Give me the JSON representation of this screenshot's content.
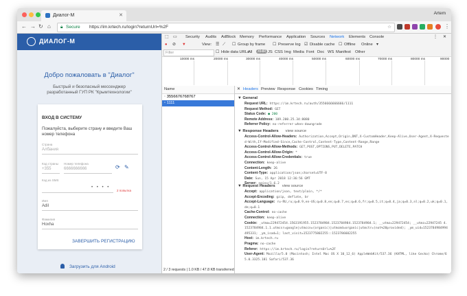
{
  "browser": {
    "tab_title": "Диалог-М",
    "user": "Artem",
    "secure_label": "Secure",
    "url": "https://im.krtech.ru/login?returnUrl=%2F"
  },
  "page": {
    "brand": "ДИАЛОГ-М",
    "welcome": "Добро пожаловать в \"Диалог\"",
    "subtitle": "Быстрый и безопасный мессенджер разработанный ГУП РК \"Крымтехнологии\"",
    "card": {
      "heading": "ВХОД В СИСТЕМУ",
      "hint": "Пожалуйста, выберите страну и введите Ваш номер телефона",
      "country_label": "Страна",
      "country_value": "Албания",
      "code_label": "Код страны",
      "code_value": "+355",
      "phone_label": "Номер телефона",
      "phone_value": "6666666666",
      "sms_label": "Код из SMS",
      "sms_dots": "• • • •",
      "resend": "2 попытка",
      "name_label": "Имя",
      "name_value": "Adil",
      "surname_label": "Фамилия",
      "surname_value": "Hoxha",
      "finish": "ЗАВЕРШИТЬ РЕГИСТРАЦИЮ"
    },
    "android": "Загрузить для Android"
  },
  "devtools": {
    "main_tabs": [
      "Security",
      "Audits",
      "AdBlock",
      "Memory",
      "Performance",
      "Application",
      "Sources",
      "Network",
      "Elements",
      "Console"
    ],
    "toolbar": {
      "view": "View:",
      "group": "Group by frame",
      "preserve": "Preserve log",
      "disable": "Disable cache",
      "offline": "Offline",
      "online": "Online"
    },
    "filter_placeholder": "Filter",
    "filter_types": [
      "Hide data URLs",
      "All",
      "XHR",
      "JS",
      "CSS",
      "Img",
      "Media",
      "Font",
      "Doc",
      "WS",
      "Manifest",
      "Other"
    ],
    "timeline_ticks": [
      "10000 ms",
      "20000 ms",
      "30000 ms",
      "40000 ms",
      "50000 ms",
      "60000 ms",
      "70000 ms",
      "80000 ms",
      "90000"
    ],
    "list_header": "Name",
    "rows": [
      "3556676768767",
      "1111"
    ],
    "status": "2 / 3 requests | 1.0 KB / 47.8 KB transferred",
    "detail_tabs": [
      "Headers",
      "Preview",
      "Response",
      "Cookies",
      "Timing"
    ],
    "general_title": "▼ General",
    "general": [
      {
        "k": "Request URL:",
        "v": "https://im.krtech.ru/auth/3556666666666/1111"
      },
      {
        "k": "Request Method:",
        "v": "GET"
      },
      {
        "k": "Status Code:",
        "v": "● 200"
      },
      {
        "k": "Remote Address:",
        "v": "109.200.25.34:8080"
      },
      {
        "k": "Referrer Policy:",
        "v": "no-referrer-when-downgrade"
      }
    ],
    "resp_title": "▼ Response Headers",
    "view_source": "view source",
    "resp": [
      {
        "k": "Access-Control-Allow-Headers:",
        "v": "Authorization,Accept,Origin,DNT,X-CustomHeader,Keep-Alive,User-Agent,X-Requested-With,If-Modified-Since,Cache-Control,Content-Type,Content-Range,Range"
      },
      {
        "k": "Access-Control-Allow-Methods:",
        "v": "GET,POST,OPTIONS,PUT,DELETE,PATCH"
      },
      {
        "k": "Access-Control-Allow-Origin:",
        "v": "*"
      },
      {
        "k": "Access-Control-Allow-Credentials:",
        "v": "true"
      },
      {
        "k": "Connection:",
        "v": "keep-alive"
      },
      {
        "k": "Content-Length:",
        "v": "26"
      },
      {
        "k": "Content-Type:",
        "v": "application/json;charset=UTF-8"
      },
      {
        "k": "Date:",
        "v": "Sun, 15 Apr 2018 12:36:56 GMT"
      },
      {
        "k": "Server:",
        "v": "nginx/1.6.2"
      }
    ],
    "req_title": "▼ Request Headers",
    "req": [
      {
        "k": "Accept:",
        "v": "application/json, text/plain, */*"
      },
      {
        "k": "Accept-Encoding:",
        "v": "gzip, deflate, br"
      },
      {
        "k": "Accept-Language:",
        "v": "ru-RU,ru;q=0.9,en-US;q=0.8,en;q=0.7,es;q=0.6,fr;q=0.5,it;q=0.4,ja;q=0.3,nl;q=0.2,uk;q=0.1,de;q=0.1"
      },
      {
        "k": "Cache-Control:",
        "v": "no-cache"
      },
      {
        "k": "Connection:",
        "v": "keep-alive"
      },
      {
        "k": "Cookie:",
        "v": "_utma=229472454.1563191955.1523784984.1523784984.1523784984.1; __utmz=229472454; __utmz=22947245 4.1523784984.1.1.utmcsr=google|utmccn=(organic)|utmcmd=organic|utmctr=(not%20provided); _ym_uid=1523784984994495331; _ym_isad=1; last_visit=1523775802255::1523786602255"
      },
      {
        "k": "Host:",
        "v": "im.krtech.ru"
      },
      {
        "k": "Pragma:",
        "v": "no-cache"
      },
      {
        "k": "Referer:",
        "v": "https://im.krtech.ru/login?returnUrl=%2F"
      },
      {
        "k": "User-Agent:",
        "v": "Mozilla/5.0 (Macintosh; Intel Mac OS X 10_12_6) AppleWebKit/537.36 (KHTML, like Gecko) Chrome/65.0.3325.181 Safari/537.36"
      }
    ]
  },
  "colors": {
    "brand": "#2b5ea8",
    "close": "#fc605b",
    "min": "#fdbc40",
    "max": "#34c84a"
  }
}
